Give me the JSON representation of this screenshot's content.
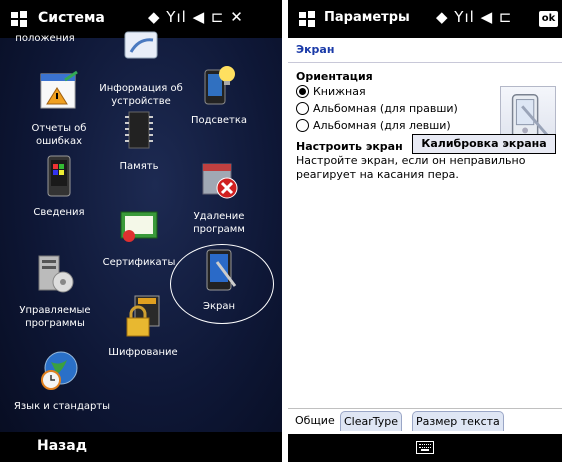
{
  "left": {
    "title": "Система",
    "status_icons": "◆ Yıl ◀ ⊏ ✕",
    "apps": [
      {
        "name": "app-personal",
        "label": "положения",
        "icon": "person-icon"
      },
      {
        "name": "app-device-info",
        "label": "Информация об устройстве",
        "icon": "pen-notepad-icon"
      },
      {
        "name": "app-error-reports",
        "label": "Отчеты об ошибках",
        "icon": "error-report-icon"
      },
      {
        "name": "app-backlight",
        "label": "Подсветка",
        "icon": "bulb-phone-icon"
      },
      {
        "name": "app-memory",
        "label": "Память",
        "icon": "memory-chip-icon"
      },
      {
        "name": "app-about",
        "label": "Сведения",
        "icon": "windows-phone-icon"
      },
      {
        "name": "app-remove-programs",
        "label": "Удаление программ",
        "icon": "remove-box-icon"
      },
      {
        "name": "app-certificates",
        "label": "Сертификаты",
        "icon": "certificate-icon"
      },
      {
        "name": "app-screen",
        "label": "Экран",
        "icon": "screen-stylus-icon"
      },
      {
        "name": "app-managed-programs",
        "label": "Управляемые программы",
        "icon": "server-disc-icon"
      },
      {
        "name": "app-encryption",
        "label": "Шифрование",
        "icon": "lock-sd-icon"
      },
      {
        "name": "app-regional",
        "label": "Язык и стандарты",
        "icon": "globe-clock-icon"
      }
    ],
    "back_label": "Назад"
  },
  "right": {
    "title": "Параметры",
    "status_icons": "◆ Yıl ◀ ⊏",
    "ok_label": "ok",
    "section": "Экран",
    "orientation_heading": "Ориентация",
    "options": [
      "Книжная",
      "Альбомная (для правши)",
      "Альбомная (для левши)"
    ],
    "selected_option": 0,
    "calibrate_heading": "Настроить экран",
    "calibrate_desc": "Настройте экран, если он неправильно реагирует на касания пера.",
    "calibrate_button": "Калибровка экрана",
    "tabs": [
      "Общие",
      "ClearType",
      "Размер текста"
    ]
  }
}
